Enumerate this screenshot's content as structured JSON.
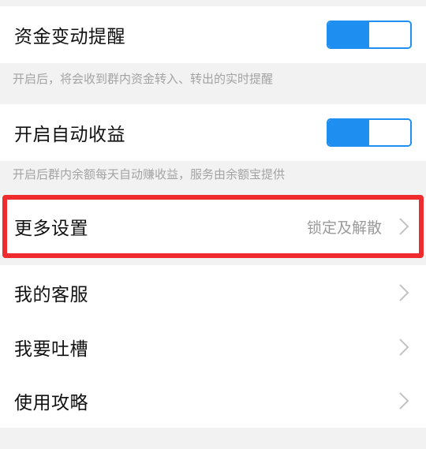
{
  "settings": {
    "fund_alert": {
      "label": "资金变动提醒",
      "enabled": true,
      "hint": "开启后，将会收到群内资金转入、转出的实时提醒"
    },
    "auto_earnings": {
      "label": "开启自动收益",
      "enabled": true,
      "hint": "开启后群内余额每天自动赚收益，服务由余额宝提供"
    }
  },
  "menu": {
    "more_settings": {
      "label": "更多设置",
      "value": "锁定及解散"
    },
    "customer_service": {
      "label": "我的客服"
    },
    "feedback": {
      "label": "我要吐槽"
    },
    "guide": {
      "label": "使用攻略"
    }
  },
  "colors": {
    "toggle_on": "#1e8ff0",
    "highlight": "#ef2b2e",
    "hint_text": "#a3a3a3",
    "background": "#f2f2f2"
  },
  "icons": {
    "chevron": "chevron-right-icon"
  }
}
